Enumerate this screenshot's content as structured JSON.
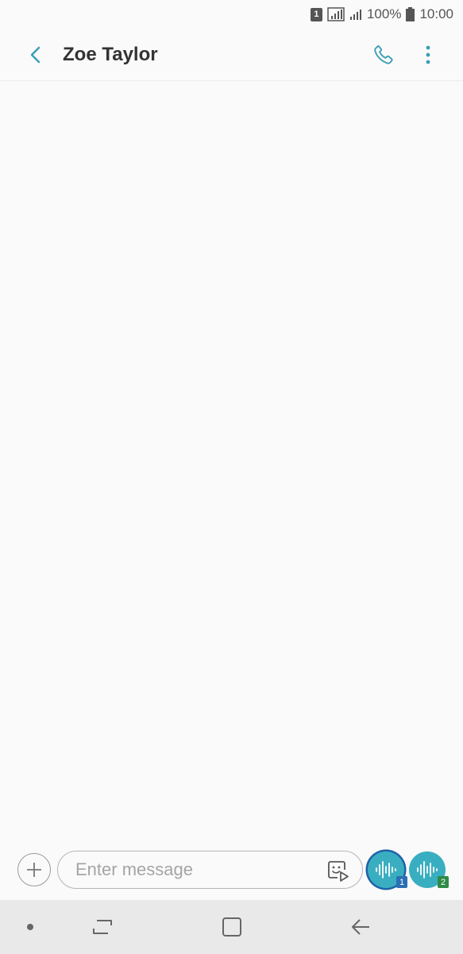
{
  "status_bar": {
    "sim_label": "1",
    "battery": "100%",
    "time": "10:00"
  },
  "header": {
    "contact_name": "Zoe Taylor",
    "icons": {
      "back": "back-arrow-icon",
      "call": "phone-icon",
      "menu": "more-vert-icon"
    }
  },
  "composer": {
    "placeholder": "Enter message",
    "value": "",
    "send_sim1_label": "1",
    "send_sim2_label": "2"
  },
  "colors": {
    "accent": "#3aaec1",
    "sim1": "#2a6fb4",
    "sim2": "#2e8a47",
    "background": "#fafafa",
    "nav_bar": "#e9e9e9"
  }
}
